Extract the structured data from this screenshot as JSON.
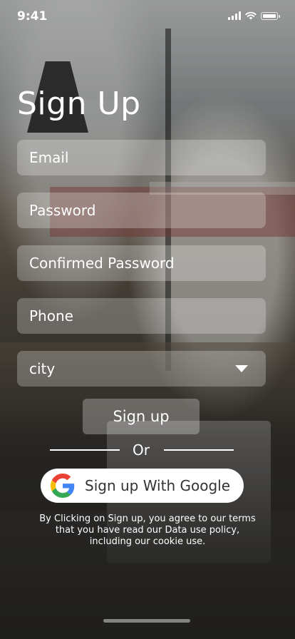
{
  "status_bar": {
    "time": "9:41"
  },
  "page": {
    "title": "Sign Up"
  },
  "form": {
    "email_placeholder": "Email",
    "password_placeholder": "Password",
    "confirm_password_placeholder": "Confirmed Password",
    "phone_placeholder": "Phone",
    "city_selected": "city"
  },
  "actions": {
    "signup_label": "Sign up",
    "or_label": "Or",
    "google_label": "Sign up With Google"
  },
  "terms": {
    "line1": "By Clicking on Sign up, you agree to our terms",
    "line2": "that you have read our Data use policy,",
    "line3": "including our cookie use."
  },
  "icons": {
    "signal": "cellular-signal-icon",
    "wifi": "wifi-icon",
    "battery": "battery-icon",
    "dropdown": "caret-down-icon",
    "google": "google-logo-icon"
  },
  "colors": {
    "field_bg": "#ffffff40",
    "google_blue": "#4285F4",
    "google_red": "#EA4335",
    "google_yellow": "#FBBC05",
    "google_green": "#34A853"
  }
}
